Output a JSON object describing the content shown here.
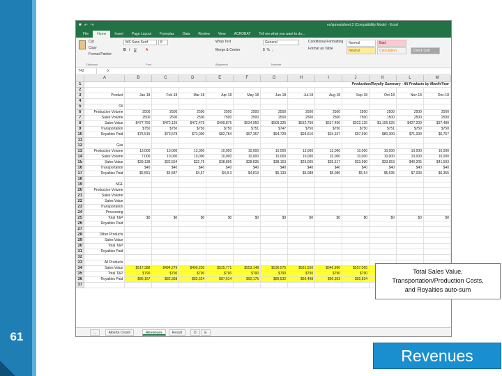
{
  "slide": {
    "number": "61",
    "title": "Revenues",
    "callout": [
      "Total Sales Value,",
      "Transportation/Production Costs,",
      "and Royalties auto-sum"
    ]
  },
  "excel": {
    "window_title": "ex/spreadsheet.3 (Compatibility Mode) - Excel",
    "ribbon_tabs": [
      "File",
      "Home",
      "Insert",
      "Page Layout",
      "Formulas",
      "Data",
      "Review",
      "View",
      "ACROBAT",
      "Tell me what you want to do..."
    ],
    "active_tab": "Home",
    "clipboard": {
      "cut": "Cut",
      "copy": "Copy",
      "format_painter": "Format Painter",
      "label": "Clipboard"
    },
    "font": {
      "name": "MS Sans Serif",
      "size": "8",
      "label": "Font"
    },
    "alignment": {
      "wrap": "Wrap Text",
      "merge": "Merge & Center",
      "label": "Alignment"
    },
    "number": {
      "format": "General",
      "label": "Number"
    },
    "styles": {
      "normal": "Normal",
      "bad": "Bad",
      "neutral": "Neutral",
      "calculation": "Calculation",
      "check_cell": "Check Cell",
      "conditional": "Conditional Formatting",
      "format_as_table": "Format as Table"
    },
    "name_box": "T42",
    "fx": "fx",
    "columns": [
      "A",
      "B",
      "C",
      "D",
      "E",
      "F",
      "G",
      "H",
      "I",
      "J",
      "K",
      "L",
      "M"
    ],
    "sheet_title": "Production/Royalty Summary - All Products by Month/Year",
    "sheet_tabs": [
      "...",
      "Alberta Crown",
      "Revenues",
      "Result",
      "D",
      "E"
    ],
    "active_sheet": "Revenues",
    "rows": [
      {
        "n": "1",
        "label": "",
        "type": "title",
        "cells": []
      },
      {
        "n": "2",
        "label": "",
        "type": "blank",
        "cells": []
      },
      {
        "n": "3",
        "label": "Product",
        "type": "months",
        "cells": [
          "Jan-18",
          "Feb-18",
          "Mar-18",
          "Apr-18",
          "May-18",
          "Jun-18",
          "Jul-18",
          "Aug-18",
          "Sep-18",
          "Oct-18",
          "Nov-18",
          "Dec-18"
        ]
      },
      {
        "n": "4",
        "label": "",
        "type": "blank",
        "cells": []
      },
      {
        "n": "5",
        "label": "Oil",
        "type": "section",
        "cells": []
      },
      {
        "n": "6",
        "label": "Production Volume",
        "type": "data",
        "cells": [
          "2500",
          "2500",
          "2500",
          "2500",
          "2500",
          "2500",
          "2500",
          "2500",
          "2500",
          "2500",
          "2500",
          "2500"
        ]
      },
      {
        "n": "7",
        "label": "Sales Volume",
        "type": "data",
        "cells": [
          "2500",
          "2500",
          "2500",
          "7500",
          "2500",
          "2500",
          "2500",
          "2500",
          "7500",
          "1500",
          "2500",
          "2500"
        ]
      },
      {
        "n": "8",
        "label": "Sales Value",
        "type": "data",
        "cells": [
          "$477,750",
          "$472,125",
          "$472,475",
          "$499,875",
          "$524,050",
          "$509,325",
          "$532,750",
          "$517,450",
          "$522,125",
          "$1,106,625",
          "$427,200",
          "$37,480"
        ]
      },
      {
        "n": "9",
        "label": "Transportation",
        "type": "data",
        "cells": [
          "$750",
          "$750",
          "$750",
          "$750",
          "$751",
          "$747",
          "$750",
          "$750",
          "$750",
          "$751",
          "$750",
          "$750"
        ]
      },
      {
        "n": "10",
        "label": "Royalties Paid",
        "type": "data",
        "cells": [
          "$75,515",
          "$73,578",
          "$73,000",
          "$82,784",
          "$97,357",
          "$94,729",
          "$93,616",
          "$34,157",
          "$97,690",
          "$80,300",
          "$71,009",
          "$6,757"
        ]
      },
      {
        "n": "11",
        "label": "",
        "type": "blank",
        "cells": []
      },
      {
        "n": "12",
        "label": "Gas",
        "type": "section",
        "cells": []
      },
      {
        "n": "13",
        "label": "Production Volume",
        "type": "data",
        "cells": [
          "13,000",
          "13,000",
          "13,000",
          "10,000",
          "10,000",
          "10,000",
          "13,000",
          "13,000",
          "10,000",
          "10,000",
          "10,000",
          "10,000"
        ]
      },
      {
        "n": "14",
        "label": "Sales Volume",
        "type": "data",
        "cells": [
          "7,000",
          "10,000",
          "10,000",
          "10,000",
          "10,000",
          "10,000",
          "10,000",
          "10,000",
          "10,000",
          "10,000",
          "10,000",
          "10,000"
        ]
      },
      {
        "n": "15",
        "label": "Sales Value",
        "type": "data",
        "cells": [
          "$39,138",
          "$32,554",
          "$32,76",
          "$38,896",
          "$28,835",
          "$38,153",
          "$25,005",
          "$35,517",
          "$33,990",
          "$33,953",
          "$40,205",
          "$41,593"
        ]
      },
      {
        "n": "16",
        "label": "Transportation",
        "type": "data",
        "cells": [
          "$40",
          "$40",
          "$40",
          "$40",
          "$40",
          "$40",
          "$40",
          "$40",
          "$40",
          "$40",
          "$40",
          "$40"
        ]
      },
      {
        "n": "17",
        "label": "Royalties Paid",
        "type": "data",
        "cells": [
          "$5,551",
          "$4,587",
          "$4,67",
          "$4,8.3",
          "$4,813",
          "$5,133",
          "$5,088",
          "$5,086",
          "$5,54",
          "$5,635",
          "$7,033",
          "$6,355"
        ]
      },
      {
        "n": "18",
        "label": "",
        "type": "blank",
        "cells": []
      },
      {
        "n": "19",
        "label": "NGL",
        "type": "section",
        "cells": []
      },
      {
        "n": "20",
        "label": "Production Volume",
        "type": "data",
        "cells": []
      },
      {
        "n": "21",
        "label": "Sales Volume",
        "type": "data",
        "cells": []
      },
      {
        "n": "22",
        "label": "Sales Value",
        "type": "data",
        "cells": []
      },
      {
        "n": "23",
        "label": "Transportation",
        "type": "data",
        "cells": []
      },
      {
        "n": "24",
        "label": "Processing",
        "type": "data",
        "cells": []
      },
      {
        "n": "25",
        "label": "Total T&P",
        "type": "data",
        "cells": [
          "$0",
          "$0",
          "$0",
          "$0",
          "$0",
          "$0",
          "$0",
          "$0",
          "$0",
          "$0",
          "$0",
          "$0"
        ]
      },
      {
        "n": "26",
        "label": "Royalties Paid",
        "type": "data",
        "cells": []
      },
      {
        "n": "27",
        "label": "",
        "type": "blank",
        "cells": []
      },
      {
        "n": "28",
        "label": "Other Products",
        "type": "section",
        "cells": []
      },
      {
        "n": "29",
        "label": "Sales Value",
        "type": "data",
        "cells": []
      },
      {
        "n": "30",
        "label": "Total T&P",
        "type": "data",
        "cells": []
      },
      {
        "n": "31",
        "label": "Royalties Paid",
        "type": "data",
        "cells": []
      },
      {
        "n": "32",
        "label": "",
        "type": "blank",
        "cells": []
      },
      {
        "n": "33",
        "label": "All Products",
        "type": "section",
        "cells": []
      },
      {
        "n": "34",
        "label": "Sales Value",
        "type": "yellow",
        "cells": [
          "$517,388",
          "$494,279",
          "$490,230",
          "$525,771",
          "$553,148",
          "$536,575",
          "$561,550",
          "$546,990",
          "$557,065",
          "$541,575",
          "$469,405",
          "$412,390"
        ]
      },
      {
        "n": "35",
        "label": "Total T&P",
        "type": "yellow",
        "cells": [
          "$790",
          "$790",
          "$790",
          "$790",
          "$790",
          "$790",
          "$790",
          "$790",
          "$790",
          "$790",
          "$790",
          "$790"
        ]
      },
      {
        "n": "36",
        "label": "Royalties Paid",
        "type": "yellow",
        "cells": [
          "$86,167",
          "$82,358",
          "$82,624",
          "$87,614",
          "$92,175",
          "$89,532",
          "$93,498",
          "$90,353",
          "$92,834",
          "$93,066",
          "$78,116",
          "$66,731"
        ]
      },
      {
        "n": "37",
        "label": "",
        "type": "blank",
        "cells": []
      }
    ]
  }
}
